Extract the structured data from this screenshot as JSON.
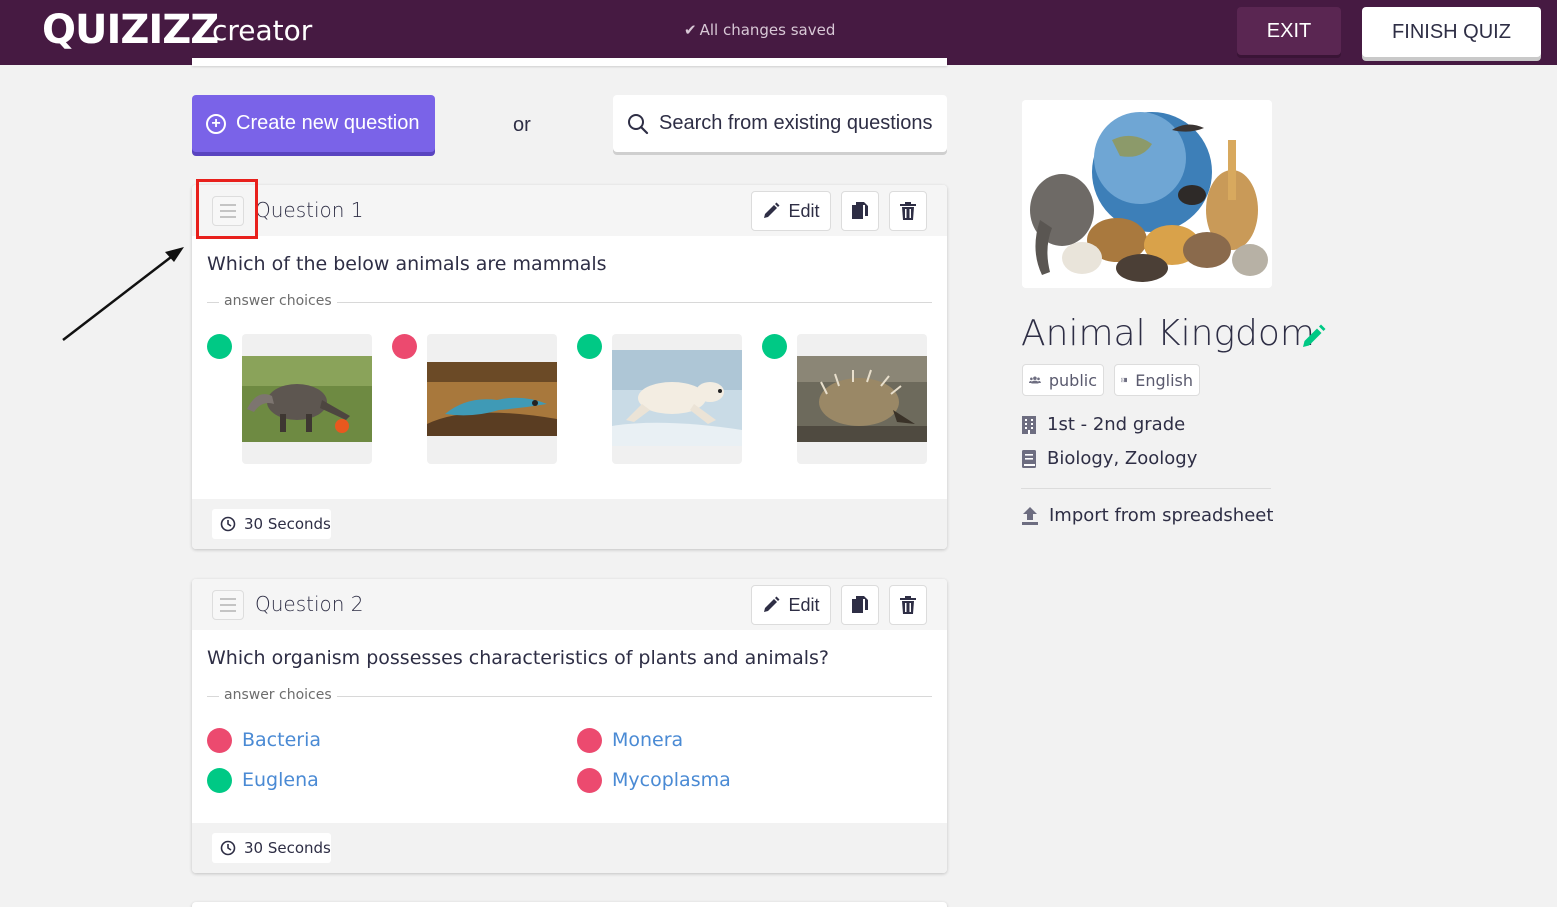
{
  "header": {
    "logo": "QUIZIZZ",
    "subtitle": "creator",
    "save_status": "All changes saved",
    "exit_label": "EXIT",
    "finish_label": "FINISH QUIZ"
  },
  "actions": {
    "create_label": "Create new question",
    "or_label": "or",
    "search_label": "Search from existing questions"
  },
  "questions": [
    {
      "title": "Question 1",
      "edit_label": "Edit",
      "text": "Which of the below animals are mammals",
      "answer_choices_label": "answer choices",
      "choices": [
        {
          "image": "anteater",
          "correct": true
        },
        {
          "image": "lizard",
          "correct": false
        },
        {
          "image": "polar-bear",
          "correct": true
        },
        {
          "image": "echidna",
          "correct": true
        }
      ],
      "time": "30 Seconds"
    },
    {
      "title": "Question 2",
      "edit_label": "Edit",
      "text": "Which organism possesses characteristics of plants and animals?",
      "answer_choices_label": "answer choices",
      "choices": [
        {
          "text": "Bacteria",
          "correct": false
        },
        {
          "text": "Monera",
          "correct": false
        },
        {
          "text": "Euglena",
          "correct": true
        },
        {
          "text": "Mycoplasma",
          "correct": false
        }
      ],
      "time": "30 Seconds"
    }
  ],
  "quiz": {
    "title": "Animal Kingdom",
    "visibility": "public",
    "language": "English",
    "grade": "1st - 2nd grade",
    "subjects": "Biology, Zoology",
    "import_label": "Import from spreadsheet"
  },
  "colors": {
    "topbar": "#461a42",
    "primary": "#7a63e8",
    "correct": "#00c985",
    "incorrect": "#ec4a6f",
    "choice_text": "#4a8ad4"
  }
}
